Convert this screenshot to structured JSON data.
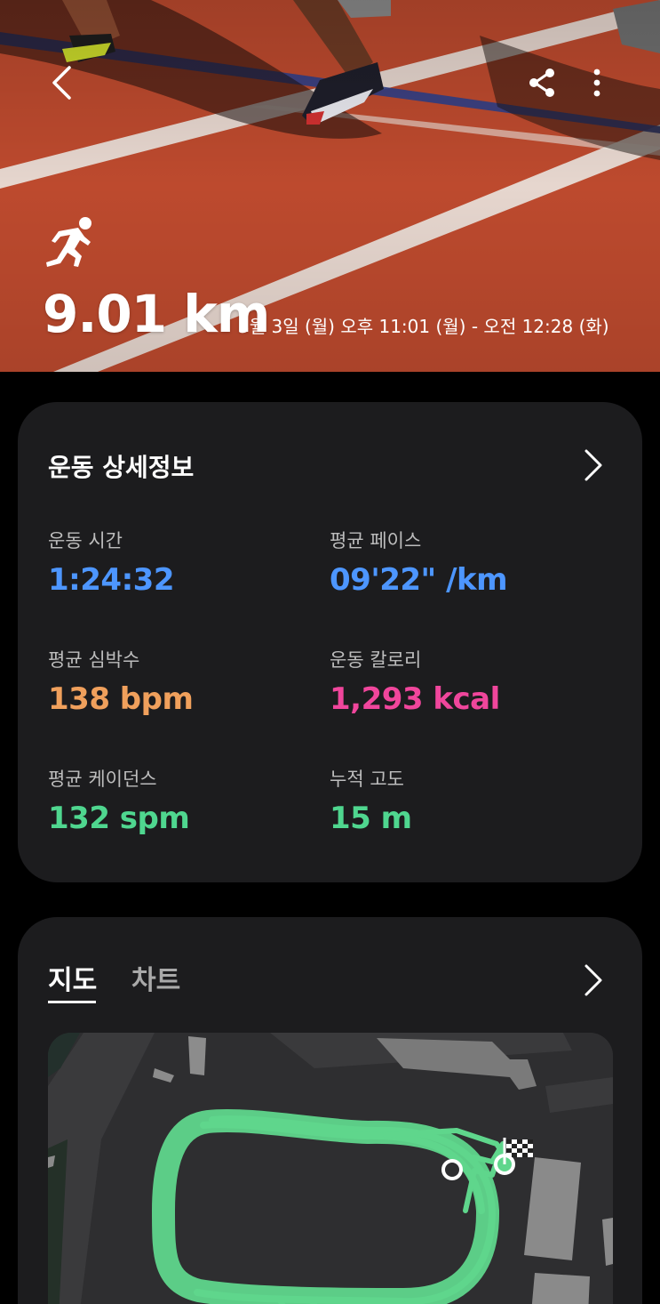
{
  "hero": {
    "distance": "9.01 km",
    "datetime": "3월 3일 (월) 오후 11:01 (월) - 오전 12:28 (화)",
    "icons": {
      "back": "chevron-left-icon",
      "share": "share-icon",
      "more": "more-vertical-icon",
      "activity": "running-icon"
    }
  },
  "details": {
    "title": "운동 상세정보",
    "stats": [
      {
        "label": "운동 시간",
        "value": "1:24:32",
        "color": "#4d96ff"
      },
      {
        "label": "평균 페이스",
        "value": "09'22\" /km",
        "color": "#4d96ff"
      },
      {
        "label": "평균 심박수",
        "value": "138 bpm",
        "color": "#f0a05c"
      },
      {
        "label": "운동 칼로리",
        "value": "1,293 kcal",
        "color": "#f0469c"
      },
      {
        "label": "평균 케이던스",
        "value": "132 spm",
        "color": "#4fd68f"
      },
      {
        "label": "누적 고도",
        "value": "15 m",
        "color": "#4fd68f"
      }
    ]
  },
  "map_card": {
    "tabs": [
      {
        "label": "지도",
        "active": true
      },
      {
        "label": "차트",
        "active": false
      }
    ],
    "route_color": "#5fd68c"
  }
}
